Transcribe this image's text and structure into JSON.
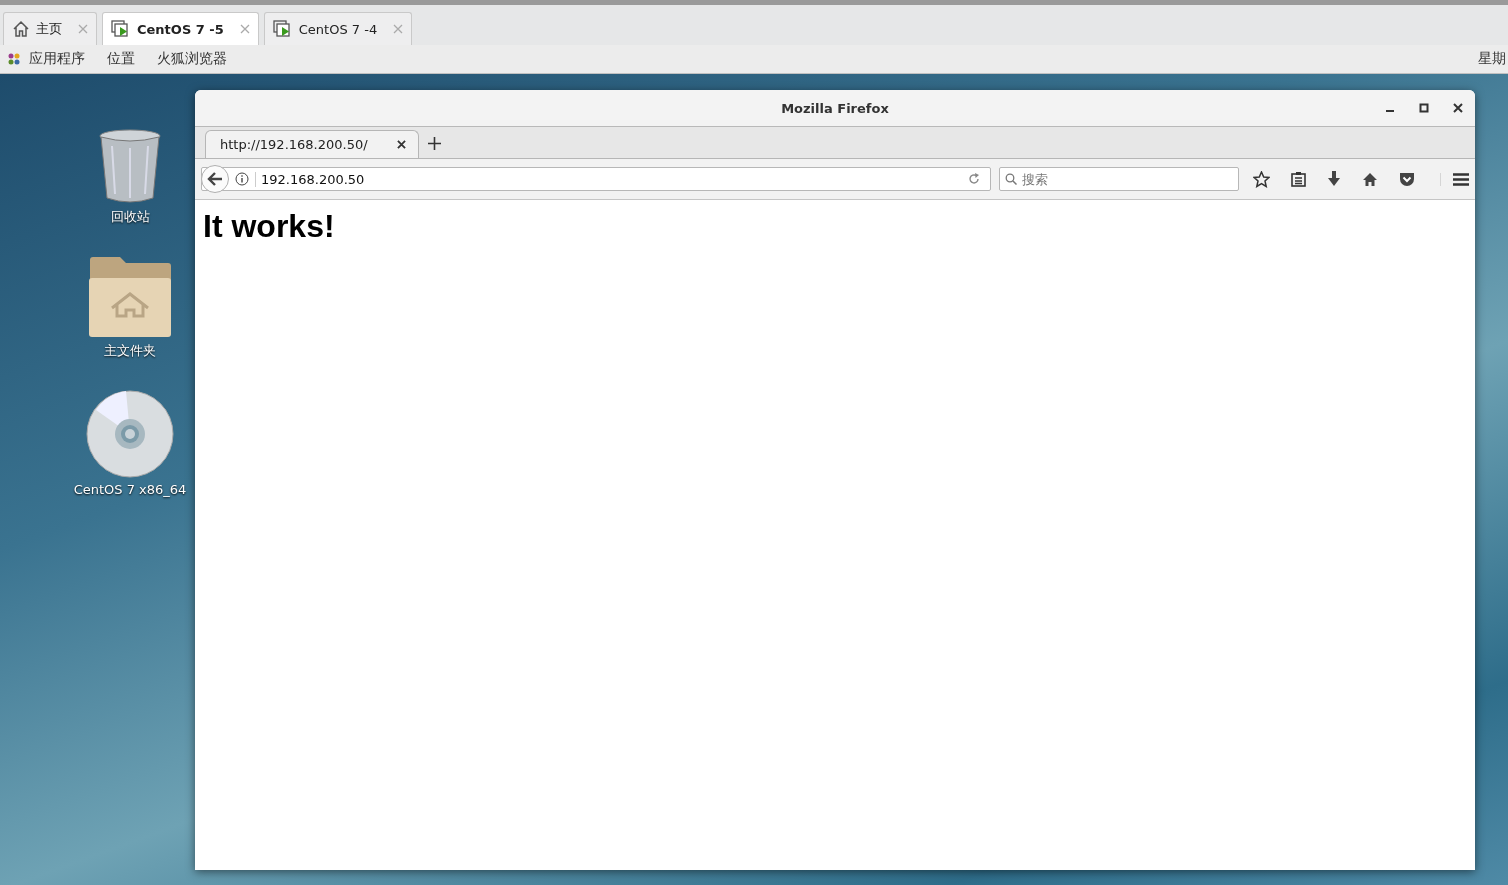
{
  "vm_tabs": [
    {
      "label": "主页",
      "kind": "home",
      "selected": false
    },
    {
      "label": "CentOS 7 -5",
      "kind": "vm",
      "selected": true
    },
    {
      "label": "CentOS 7 -4",
      "kind": "vm",
      "selected": false
    }
  ],
  "top_bar": {
    "menus": [
      "应用程序",
      "位置",
      "火狐浏览器"
    ],
    "clock": "星期"
  },
  "desktop_icons": [
    {
      "label": "回收站",
      "kind": "trash"
    },
    {
      "label": "主文件夹",
      "kind": "folder"
    },
    {
      "label": "CentOS 7 x86_64",
      "kind": "disc"
    }
  ],
  "window": {
    "title": "Mozilla Firefox",
    "tabs": [
      {
        "label": "http://192.168.200.50/",
        "selected": true
      }
    ],
    "url": "192.168.200.50",
    "search": {
      "placeholder": "搜索"
    },
    "page_heading": "It works!"
  }
}
